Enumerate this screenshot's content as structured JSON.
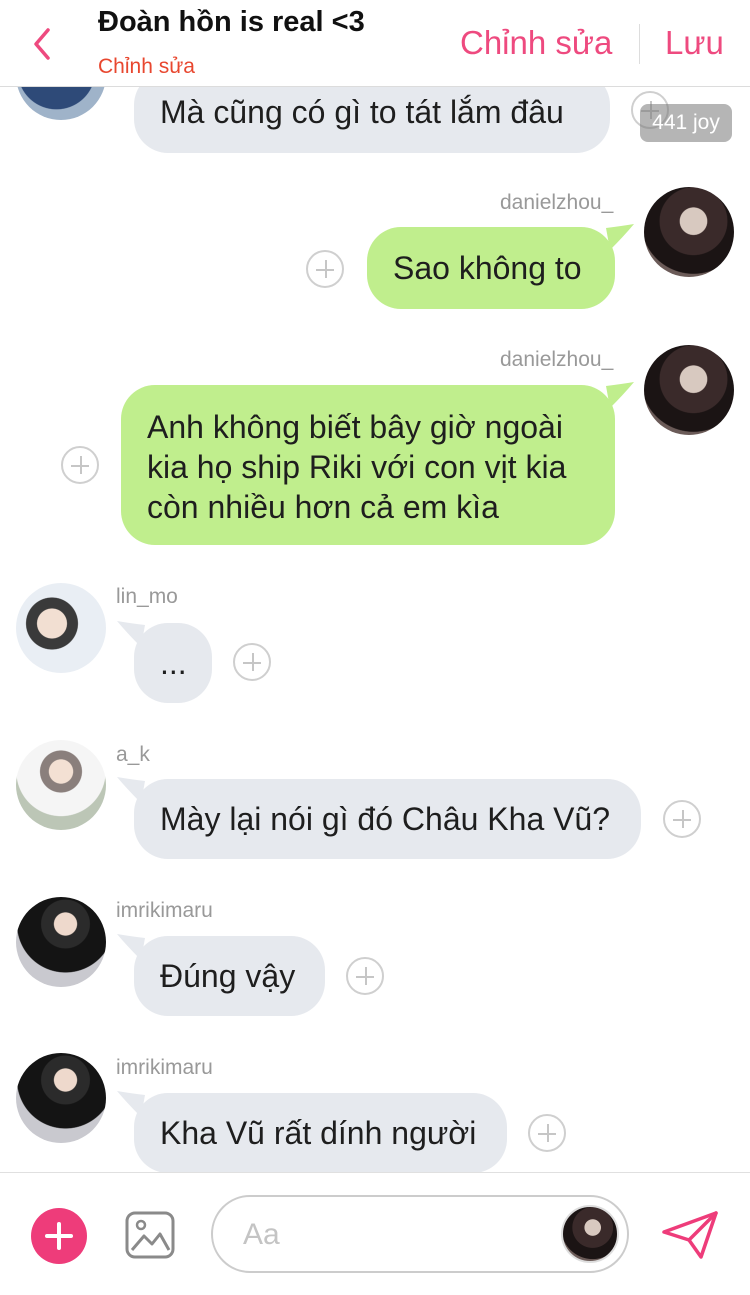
{
  "header": {
    "title": "Đoàn hồn is real <3",
    "subtitle": "Chỉnh sửa",
    "edit_label": "Chỉnh sửa",
    "save_label": "Lưu",
    "accent_color": "#ee4a7f"
  },
  "badge": {
    "text": "441 joy"
  },
  "messages": [
    {
      "sender": "",
      "text": "Mà cũng có gì to tát lắm đâu",
      "side": "left"
    },
    {
      "sender": "danielzhou_",
      "text": "Sao không to",
      "side": "right"
    },
    {
      "sender": "danielzhou_",
      "text": "Anh không biết bây giờ ngoài kia họ ship Riki với con vịt kia còn nhiều hơn cả em kìa",
      "side": "right"
    },
    {
      "sender": "lin_mo",
      "text": "...",
      "side": "left"
    },
    {
      "sender": "a_k",
      "text": "Mày lại nói gì đó Châu Kha Vũ?",
      "side": "left"
    },
    {
      "sender": "imrikimaru",
      "text": "Đúng vậy",
      "side": "left"
    },
    {
      "sender": "imrikimaru",
      "text": "Kha Vũ rất dính người",
      "side": "left"
    }
  ],
  "composer": {
    "placeholder": "Aa"
  },
  "colors": {
    "outgoing_bubble": "#c0ee8d",
    "incoming_bubble": "#e6e9ee",
    "add_button": "#ee3c7a"
  }
}
